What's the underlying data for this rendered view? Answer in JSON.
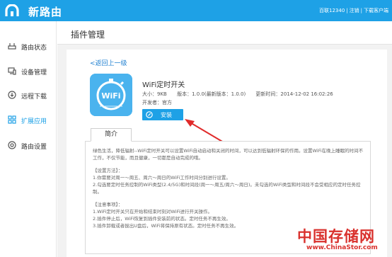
{
  "header": {
    "brand": "新路由",
    "account": "百联12340",
    "logout": "注销",
    "download": "下载客户端"
  },
  "sidebar": {
    "items": [
      {
        "label": "路由状态",
        "icon": "router-status-icon"
      },
      {
        "label": "设备管理",
        "icon": "device-manage-icon"
      },
      {
        "label": "远程下载",
        "icon": "remote-download-icon"
      },
      {
        "label": "扩展应用",
        "icon": "extension-apps-icon",
        "active": true
      },
      {
        "label": "路由设置",
        "icon": "router-settings-icon"
      }
    ]
  },
  "main": {
    "title": "插件管理",
    "back_link": "<返回上一级",
    "plugin": {
      "name": "WiFi定时开关",
      "icon_text": "WiFi",
      "size": "大小：9KB",
      "version": "版本：1.0.0(最新版本：1.0.0)",
      "updated": "更新时间：2014-12-02 16:02:26",
      "developer": "开发者：官方",
      "install_label": "安装"
    },
    "tab_label": "简介",
    "description": [
      "绿色生活，降低辐射--WiFi定时开关可以设置WiFi自动启动和关闭的时间，可以达到低辐射环保的作用。设置WiFi在晚上睡眠的时间不工作，不仅节能，而且健康，一切都是自动完成的哦。",
      "【设置方法】：",
      "1.你需要对周一～周五、周六～周日的WiFi工作时间分别进行设置。",
      "2.勾选要定时任务控制的WiFi类型(2.4/5G)和时间段(周一～周五/周六～周日)。未勾选的WiFi类型和时间段不会受相应的定时任务控制。",
      "【注意事项】：",
      "1.WiFi定时开关只在开始和结束时刻对WiFi进行开关操作。",
      "2.插件停止后，WiFi恢复到插件安装前的状态。定时任务不再生效。",
      "3.插件卸载或者拔出U盘后，WiFi将保持原有状态。定时任务不再生效。"
    ]
  },
  "watermark": {
    "cn": "中国存储网",
    "url": "www.ChinaStor.com"
  },
  "colors": {
    "accent": "#1ea1e6",
    "link": "#1e7fd0",
    "arrow": "#e02b2b",
    "watermark": "#d9312d"
  }
}
